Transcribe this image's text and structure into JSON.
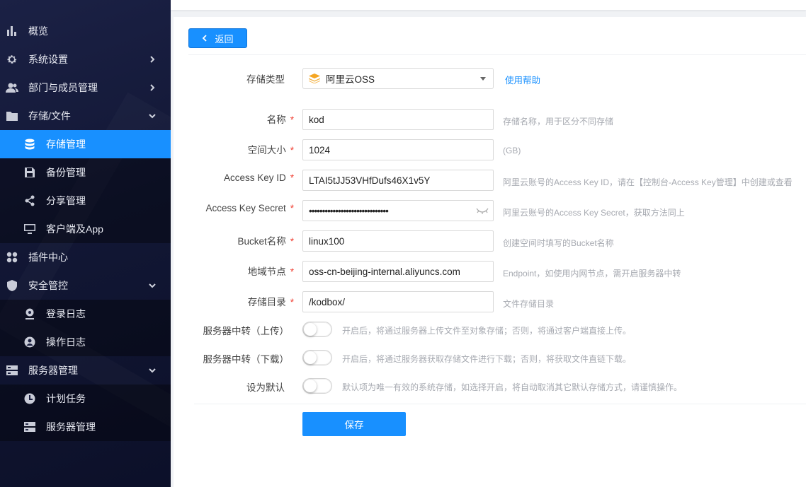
{
  "sidebar": {
    "items": [
      {
        "label": "概览",
        "icon": "bar-chart-icon"
      },
      {
        "label": "系统设置",
        "icon": "gear-icon"
      },
      {
        "label": "部门与成员管理",
        "icon": "users-icon"
      },
      {
        "label": "存储/文件",
        "icon": "folder-icon"
      },
      {
        "label": "存储管理",
        "icon": "database-icon"
      },
      {
        "label": "备份管理",
        "icon": "save-icon"
      },
      {
        "label": "分享管理",
        "icon": "share-icon"
      },
      {
        "label": "客户端及App",
        "icon": "monitor-icon"
      },
      {
        "label": "插件中心",
        "icon": "grid-icon"
      },
      {
        "label": "安全管控",
        "icon": "shield-icon"
      },
      {
        "label": "登录日志",
        "icon": "login-log-icon"
      },
      {
        "label": "操作日志",
        "icon": "user-log-icon"
      },
      {
        "label": "服务器管理",
        "icon": "server-icon"
      },
      {
        "label": "计划任务",
        "icon": "clock-icon"
      },
      {
        "label": "服务器管理",
        "icon": "server-icon"
      }
    ]
  },
  "main": {
    "back_label": "返回",
    "storage_type": {
      "label": "存储类型",
      "value": "阿里云OSS",
      "help": "使用帮助"
    },
    "fields": [
      {
        "label": "名称",
        "value": "kod",
        "hint": "存储名称，用于区分不同存储"
      },
      {
        "label": "空间大小",
        "value": "1024",
        "hint": "(GB)"
      },
      {
        "label": "Access Key ID",
        "value": "LTAI5tJJ53VHfDufs46X1v5Y",
        "hint": "阿里云账号的Access Key ID，请在【控制台-Access Key管理】中创建或查看"
      },
      {
        "label": "Access Key Secret",
        "value": "••••••••••••••••••••••••••••••",
        "hint": "阿里云账号的Access Key Secret，获取方法同上"
      },
      {
        "label": "Bucket名称",
        "value": "linux100",
        "hint": "创建空间时填写的Bucket名称"
      },
      {
        "label": "地域节点",
        "value": "oss-cn-beijing-internal.aliyuncs.com",
        "hint": "Endpoint，如使用内网节点，需开启服务器中转"
      },
      {
        "label": "存储目录",
        "value": "/kodbox/",
        "hint": "文件存储目录"
      }
    ],
    "switches": [
      {
        "label": "服务器中转（上传）",
        "hint": "开启后，将通过服务器上传文件至对象存储；否则，将通过客户端直接上传。"
      },
      {
        "label": "服务器中转（下载）",
        "hint": "开启后，将通过服务器获取存储文件进行下载；否则，将获取文件直链下载。"
      },
      {
        "label": "设为默认",
        "hint": "默认项为唯一有效的系统存储，如选择开启，将自动取消其它默认存储方式，请谨慎操作。"
      }
    ],
    "save_label": "保存",
    "required_mark": "*"
  },
  "colors": {
    "accent": "#1890ff",
    "required": "#f04134"
  }
}
